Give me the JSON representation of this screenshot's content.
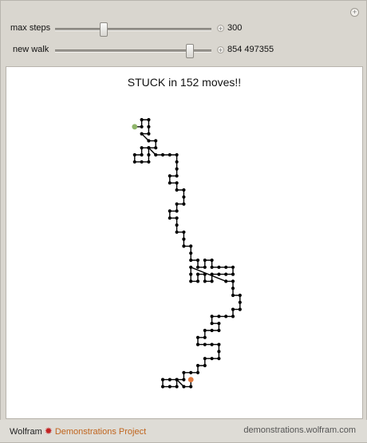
{
  "controls": {
    "max_steps": {
      "label": "max steps",
      "value": "300",
      "fraction": 0.31
    },
    "new_walk": {
      "label": "new walk",
      "value": "854 497355",
      "fraction": 0.86
    }
  },
  "corner_button": "+",
  "control_plus": "+",
  "status": "STUCK in 152 moves!!",
  "walk": {
    "path": [
      [
        1,
        1
      ],
      [
        2,
        1
      ],
      [
        2,
        0
      ],
      [
        3,
        0
      ],
      [
        3,
        1
      ],
      [
        3,
        2
      ],
      [
        2,
        2
      ],
      [
        3,
        3
      ],
      [
        4,
        3
      ],
      [
        4,
        4
      ],
      [
        3,
        4
      ],
      [
        2,
        4
      ],
      [
        2,
        5
      ],
      [
        1,
        5
      ],
      [
        1,
        6
      ],
      [
        2,
        6
      ],
      [
        3,
        6
      ],
      [
        3,
        5
      ],
      [
        3,
        4
      ],
      [
        4,
        5
      ],
      [
        5,
        5
      ],
      [
        6,
        5
      ],
      [
        7,
        5
      ],
      [
        7,
        6
      ],
      [
        7,
        7
      ],
      [
        7,
        8
      ],
      [
        6,
        8
      ],
      [
        6,
        9
      ],
      [
        7,
        9
      ],
      [
        7,
        10
      ],
      [
        8,
        10
      ],
      [
        8,
        11
      ],
      [
        8,
        12
      ],
      [
        7,
        12
      ],
      [
        7,
        13
      ],
      [
        6,
        13
      ],
      [
        6,
        14
      ],
      [
        7,
        14
      ],
      [
        7,
        15
      ],
      [
        7,
        16
      ],
      [
        8,
        16
      ],
      [
        8,
        17
      ],
      [
        8,
        18
      ],
      [
        9,
        18
      ],
      [
        9,
        19
      ],
      [
        9,
        20
      ],
      [
        10,
        20
      ],
      [
        10,
        21
      ],
      [
        11,
        21
      ],
      [
        11,
        20
      ],
      [
        12,
        20
      ],
      [
        12,
        21
      ],
      [
        13,
        21
      ],
      [
        14,
        21
      ],
      [
        15,
        21
      ],
      [
        15,
        22
      ],
      [
        14,
        22
      ],
      [
        13,
        22
      ],
      [
        12,
        22
      ],
      [
        12,
        23
      ],
      [
        11,
        23
      ],
      [
        11,
        22
      ],
      [
        10,
        22
      ],
      [
        10,
        23
      ],
      [
        9,
        23
      ],
      [
        9,
        22
      ],
      [
        9,
        21
      ],
      [
        14,
        23
      ],
      [
        15,
        23
      ],
      [
        15,
        24
      ],
      [
        15,
        25
      ],
      [
        16,
        25
      ],
      [
        16,
        26
      ],
      [
        16,
        27
      ],
      [
        15,
        27
      ],
      [
        15,
        28
      ],
      [
        14,
        28
      ],
      [
        13,
        28
      ],
      [
        12,
        28
      ],
      [
        12,
        29
      ],
      [
        13,
        29
      ],
      [
        13,
        30
      ],
      [
        12,
        30
      ],
      [
        11,
        30
      ],
      [
        11,
        31
      ],
      [
        10,
        31
      ],
      [
        10,
        32
      ],
      [
        11,
        32
      ],
      [
        12,
        32
      ],
      [
        13,
        32
      ],
      [
        13,
        33
      ],
      [
        13,
        34
      ],
      [
        12,
        34
      ],
      [
        11,
        34
      ],
      [
        11,
        35
      ],
      [
        10,
        35
      ],
      [
        10,
        36
      ],
      [
        9,
        36
      ],
      [
        8,
        36
      ],
      [
        8,
        37
      ],
      [
        7,
        37
      ],
      [
        6,
        37
      ],
      [
        5,
        37
      ],
      [
        5,
        38
      ],
      [
        6,
        38
      ],
      [
        7,
        38
      ],
      [
        7,
        37
      ],
      [
        8,
        38
      ],
      [
        9,
        38
      ],
      [
        9,
        37
      ]
    ],
    "start_color": "#8fb56a",
    "end_color": "#e07a3f",
    "line_color": "#000000"
  },
  "footer": {
    "wolfram": "Wolfram",
    "logo_glyph": "✹",
    "demonstrations": "Demonstrations Project",
    "site": "demonstrations.wolfram.com"
  }
}
